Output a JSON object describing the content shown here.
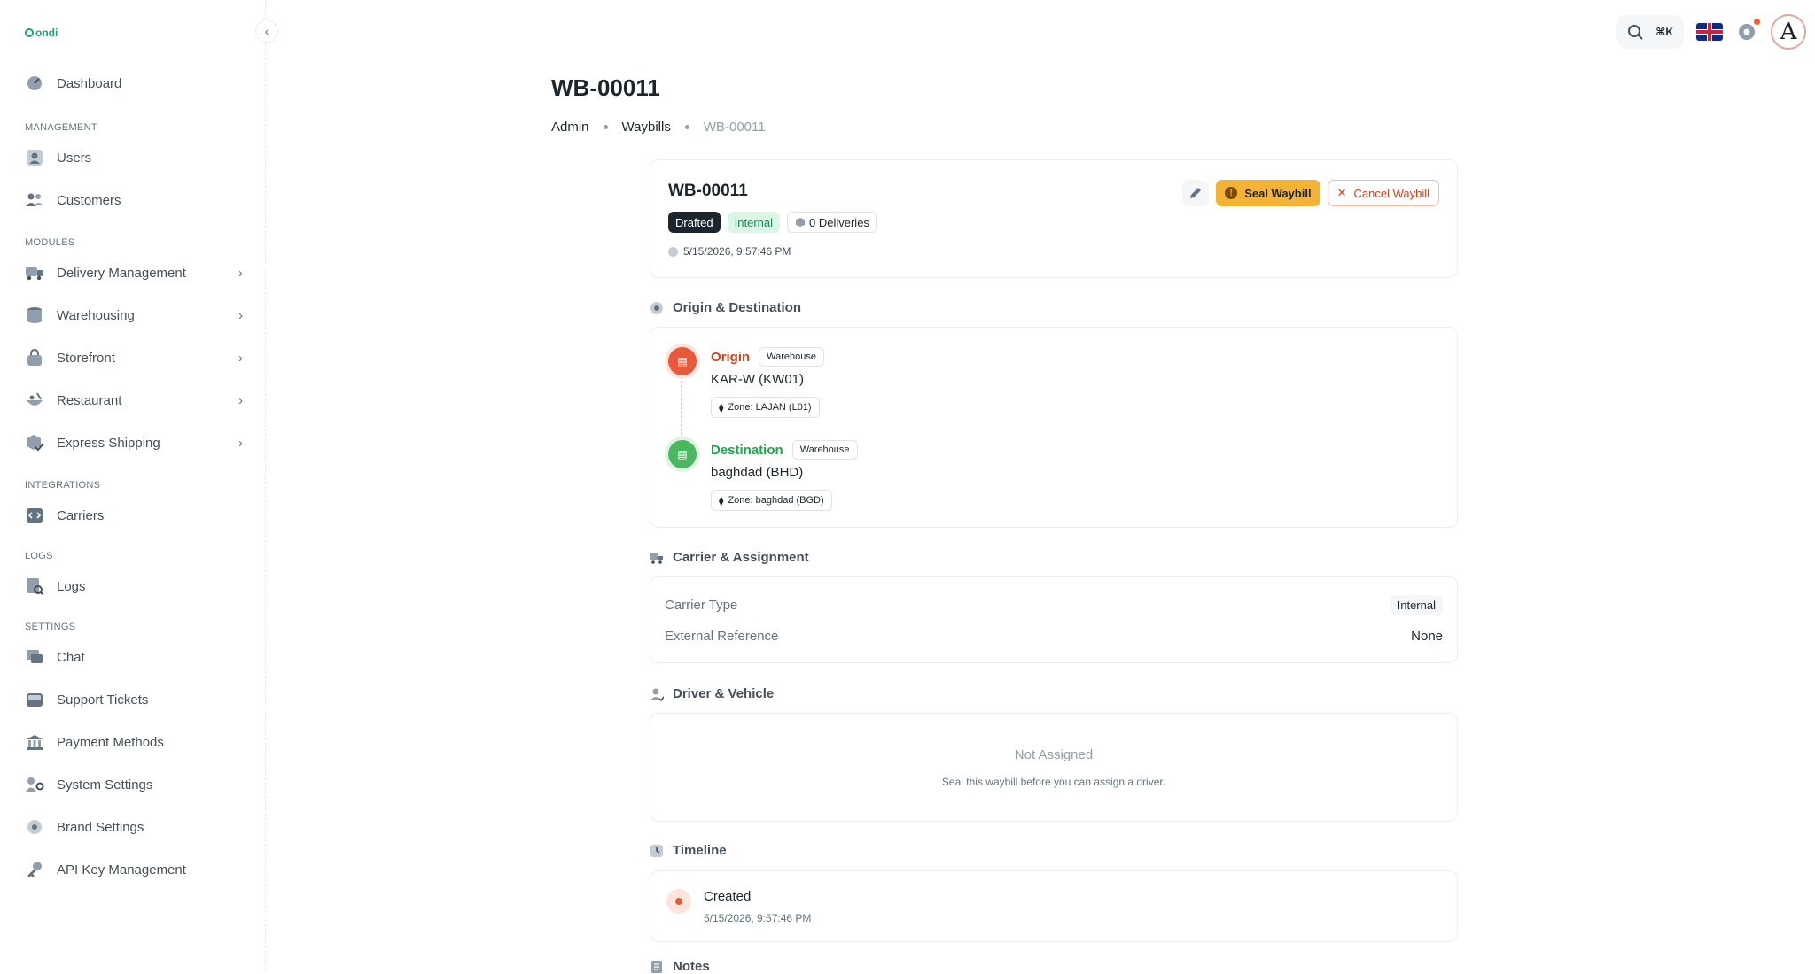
{
  "brand": {
    "logo_text": "ondi"
  },
  "sidebar": {
    "items_top": [
      {
        "label": "Dashboard",
        "icon": "dashboard-icon"
      }
    ],
    "sections": [
      {
        "title": "MANAGEMENT",
        "items": [
          {
            "label": "Users"
          },
          {
            "label": "Customers"
          }
        ]
      },
      {
        "title": "MODULES",
        "items": [
          {
            "label": "Delivery Management"
          },
          {
            "label": "Warehousing"
          },
          {
            "label": "Storefront"
          },
          {
            "label": "Restaurant"
          },
          {
            "label": "Express Shipping"
          }
        ]
      },
      {
        "title": "INTEGRATIONS",
        "items": [
          {
            "label": "Carriers"
          }
        ]
      },
      {
        "title": "LOGS",
        "items": [
          {
            "label": "Logs"
          }
        ]
      },
      {
        "title": "SETTINGS",
        "items": [
          {
            "label": "Chat"
          },
          {
            "label": "Support Tickets"
          },
          {
            "label": "Payment Methods"
          },
          {
            "label": "System Settings"
          },
          {
            "label": "Brand Settings"
          },
          {
            "label": "API Key Management"
          }
        ]
      }
    ]
  },
  "topbar": {
    "shortcut": "⌘K"
  },
  "page": {
    "title": "WB-00011",
    "breadcrumb": [
      "Admin",
      "Waybills",
      "WB-00011"
    ]
  },
  "waybill": {
    "code": "WB-00011",
    "status": "Drafted",
    "type": "Internal",
    "deliveries": "0 Deliveries",
    "created_at": "5/15/2026, 9:57:46 PM",
    "seal_label": "Seal Waybill",
    "cancel_label": "Cancel Waybill"
  },
  "origin_destination": {
    "section_title": "Origin & Destination",
    "origin": {
      "label": "Origin",
      "kind": "Warehouse",
      "name": "KAR-W (KW01)",
      "zone": "Zone: LAJAN (L01)"
    },
    "destination": {
      "label": "Destination",
      "kind": "Warehouse",
      "name": "baghdad (BHD)",
      "zone": "Zone: baghdad (BGD)"
    }
  },
  "carrier": {
    "section_title": "Carrier & Assignment",
    "carrier_type_label": "Carrier Type",
    "carrier_type_value": "Internal",
    "external_ref_label": "External Reference",
    "external_ref_value": "None"
  },
  "driver": {
    "section_title": "Driver & Vehicle",
    "empty_title": "Not Assigned",
    "empty_sub": "Seal this waybill before you can assign a driver."
  },
  "timeline": {
    "section_title": "Timeline",
    "events": [
      {
        "title": "Created",
        "time": "5/15/2026, 9:57:46 PM"
      }
    ]
  },
  "notes": {
    "section_title": "Notes"
  },
  "colors": {
    "accent_warning": "#f5b335",
    "error": "#d3401d",
    "success": "#1fa64a",
    "dark": "#1c252e"
  }
}
